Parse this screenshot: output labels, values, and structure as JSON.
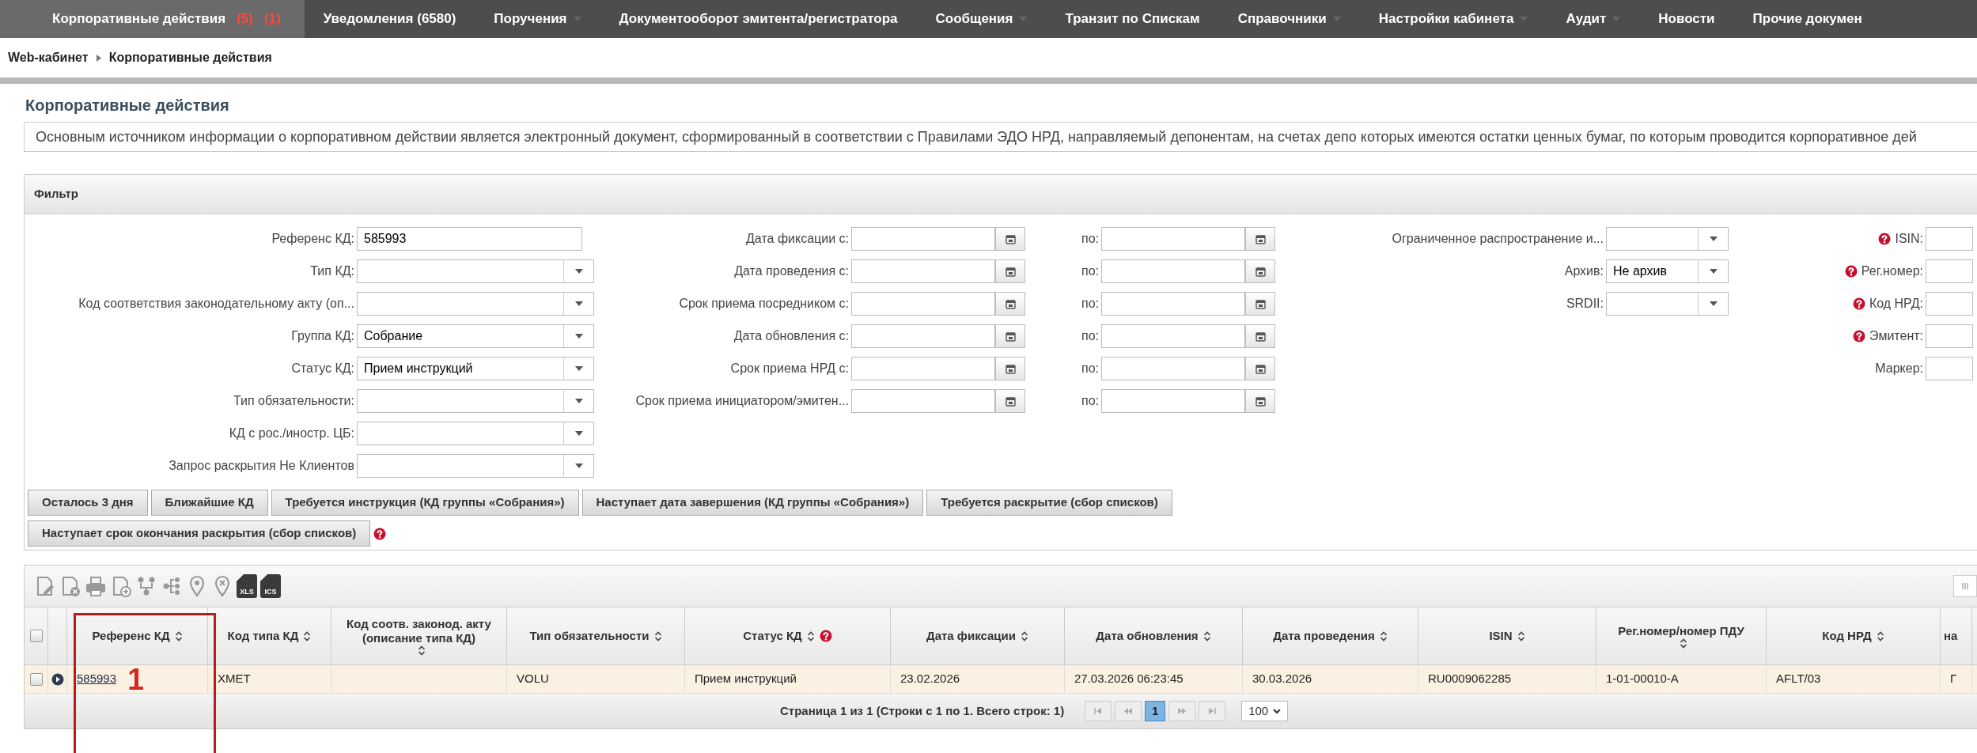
{
  "nav": [
    {
      "label": "Корпоративные действия",
      "counters": [
        "(5)",
        "(1)"
      ],
      "dropdown": false,
      "selected": true
    },
    {
      "label": "Уведомления (6580)",
      "dropdown": false,
      "selected": false
    },
    {
      "label": "Поручения",
      "dropdown": true,
      "selected": false
    },
    {
      "label": "Документооборот эмитента/регистратора",
      "dropdown": false,
      "selected": false
    },
    {
      "label": "Сообщения",
      "dropdown": true,
      "selected": false
    },
    {
      "label": "Транзит по Спискам",
      "dropdown": false,
      "selected": false
    },
    {
      "label": "Справочники",
      "dropdown": true,
      "selected": false
    },
    {
      "label": "Настройки кабинета",
      "dropdown": true,
      "selected": false
    },
    {
      "label": "Аудит",
      "dropdown": true,
      "selected": false
    },
    {
      "label": "Новости",
      "dropdown": false,
      "selected": false
    },
    {
      "label": "Прочие докумен",
      "dropdown": false,
      "selected": false
    }
  ],
  "breadcrumb": [
    "Web-кабинет",
    "Корпоративные действия"
  ],
  "page_title": "Корпоративные действия",
  "info_text": "Основным источником информации о корпоративном действии является электронный документ, сформированный в соответствии с Правилами ЭДО НРД, направляемый депонентам, на счетах депо которых имеются остатки ценных бумаг, по которым проводится корпоративное дей",
  "filter": {
    "title": "Фильтр",
    "column_1": [
      {
        "label": "Референс КД:",
        "kind": "text",
        "value": "585993"
      },
      {
        "label": "Тип КД:",
        "kind": "select"
      },
      {
        "label": "Код соответствия законодательному акту (оп...",
        "kind": "select"
      },
      {
        "label": "Группа КД:",
        "kind": "select",
        "value": "Собрание"
      },
      {
        "label": "Статус КД:",
        "kind": "select",
        "value": "Прием инструкций"
      },
      {
        "label": "Тип обязательности:",
        "kind": "select"
      },
      {
        "label": "КД с рос./иностр. ЦБ:",
        "kind": "select"
      },
      {
        "label": "Запрос раскрытия Не Клиентов",
        "kind": "select"
      }
    ],
    "column_2": [
      {
        "label": "Дата фиксации с:",
        "to_label": "по:"
      },
      {
        "label": "Дата проведения с:",
        "to_label": "по:"
      },
      {
        "label": "Срок приема посредником с:",
        "to_label": "по:"
      },
      {
        "label": "Дата обновления с:",
        "to_label": "по:"
      },
      {
        "label": "Срок приема НРД с:",
        "to_label": "по:"
      },
      {
        "label": "Срок приема инициатором/эмитен...",
        "to_label": "по:"
      }
    ],
    "column_3": [
      {
        "label": "Ограниченное распространение и...",
        "kind": "select"
      },
      {
        "label": "Архив:",
        "kind": "select",
        "value": "Не архив"
      },
      {
        "label": "SRDII:",
        "kind": "select"
      }
    ],
    "column_4": [
      {
        "label": "ISIN:",
        "help": true
      },
      {
        "label": "Рег.номер:",
        "help": true
      },
      {
        "label": "Код НРД:",
        "help": true
      },
      {
        "label": "Эмитент:",
        "help": true
      },
      {
        "label": "Маркер:",
        "help": false
      }
    ],
    "quick_buttons": [
      "Осталось 3 дня",
      "Ближайшие КД",
      "Требуется инструкция (КД группы «Собрания»)",
      "Наступает дата завершения (КД группы «Собрания»)",
      "Требуется раскрытие (сбор списков)",
      "Наступает срок окончания раскрытия (сбор списков)"
    ]
  },
  "toolbar": [
    {
      "kind": "edit"
    },
    {
      "kind": "delete"
    },
    {
      "kind": "print"
    },
    {
      "kind": "add"
    },
    {
      "kind": "hierarchy"
    },
    {
      "kind": "tree"
    },
    {
      "kind": "pin"
    },
    {
      "kind": "pin-x"
    },
    {
      "kind": "file",
      "label": "XLS"
    },
    {
      "kind": "file",
      "label": "ICS"
    }
  ],
  "table": {
    "select_all": {
      "checked": false
    },
    "columns": [
      {
        "label": "Референс КД",
        "sortable": true,
        "help": false
      },
      {
        "label": "Код типа КД",
        "sortable": true,
        "help": false
      },
      {
        "label": "Код соотв. законод. акту (описание типа КД)",
        "sortable": true,
        "help": false
      },
      {
        "label": "Тип обязательности",
        "sortable": true,
        "help": false
      },
      {
        "label": "Статус КД",
        "sortable": true,
        "help": true
      },
      {
        "label": "Дата фиксации",
        "sortable": true,
        "help": false
      },
      {
        "label": "Дата обновления",
        "sortable": true,
        "help": false
      },
      {
        "label": "Дата проведения",
        "sortable": true,
        "help": false
      },
      {
        "label": "ISIN",
        "sortable": true,
        "help": false
      },
      {
        "label": "Рег.номер/номер ПДУ",
        "sortable": true,
        "help": false
      },
      {
        "label": "Код НРД",
        "sortable": true,
        "help": false
      },
      {
        "label": "на",
        "sortable": false,
        "help": false
      }
    ],
    "rows": [
      {
        "checked": false,
        "cells": [
          "585993",
          "XMET",
          "",
          "VOLU",
          "Прием инструкций",
          "23.02.2026",
          "27.03.2026 06:23:45",
          "30.03.2026",
          "RU0009062285",
          "1-01-00010-A",
          "AFLT/03",
          "Г"
        ]
      }
    ]
  },
  "pager": {
    "summary": "Страница 1 из 1 (Строки с 1 по 1. Всего строк: 1)",
    "pages": [
      {
        "label": "1",
        "selected": true
      }
    ],
    "page_size": "100"
  },
  "annotation": {
    "number": "1"
  }
}
